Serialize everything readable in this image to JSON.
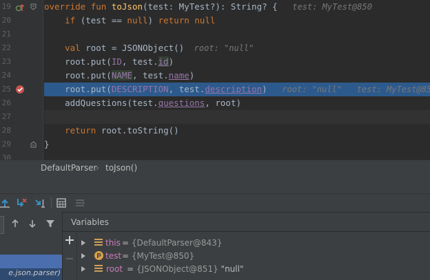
{
  "editor": {
    "line_numbers": [
      "19",
      "20",
      "21",
      "22",
      "23",
      "24",
      "25",
      "26",
      "27",
      "28",
      "29",
      "30"
    ],
    "lines": [
      {
        "segments": [
          {
            "t": "override fun ",
            "c": "kw"
          },
          {
            "t": "toJson",
            "c": "fn"
          },
          {
            "t": "(test: MyTest?): String? {",
            "c": "par"
          },
          {
            "t": "   test: MyTest@850",
            "c": "hint"
          }
        ]
      },
      {
        "segments": [
          {
            "t": "    if ",
            "c": "kw"
          },
          {
            "t": "(test == ",
            "c": "par"
          },
          {
            "t": "null",
            "c": "kw"
          },
          {
            "t": ") ",
            "c": "par"
          },
          {
            "t": "return null",
            "c": "kw"
          }
        ]
      },
      {
        "segments": []
      },
      {
        "segments": [
          {
            "t": "    val ",
            "c": "kw"
          },
          {
            "t": "root = JSONObject()",
            "c": "par"
          },
          {
            "t": "  root: \"null\"",
            "c": "hint"
          }
        ]
      },
      {
        "segments": [
          {
            "t": "    root.put(",
            "c": "par"
          },
          {
            "t": "ID",
            "c": "prop"
          },
          {
            "t": ", test.",
            "c": "par"
          },
          {
            "t": "id",
            "c": "prop-ul"
          },
          {
            "t": ")",
            "c": "par"
          }
        ]
      },
      {
        "segments": [
          {
            "t": "    root.put(",
            "c": "par"
          },
          {
            "t": "NAME",
            "c": "prop"
          },
          {
            "t": ", test.",
            "c": "par"
          },
          {
            "t": "name",
            "c": "prop-ul"
          },
          {
            "t": ")",
            "c": "par"
          }
        ]
      },
      {
        "segments": [
          {
            "t": "    root.put(",
            "c": "par"
          },
          {
            "t": "DESCRIPTION",
            "c": "prop"
          },
          {
            "t": ", test.",
            "c": "par"
          },
          {
            "t": "description",
            "c": "prop-ul"
          },
          {
            "t": ")",
            "c": "par"
          },
          {
            "t": "   root: \"null\"   test: MyTest@850",
            "c": "hint"
          }
        ]
      },
      {
        "segments": [
          {
            "t": "    addQuestions(test.",
            "c": "par"
          },
          {
            "t": "questions",
            "c": "prop-ul"
          },
          {
            "t": ", root)",
            "c": "par"
          }
        ]
      },
      {
        "segments": []
      },
      {
        "segments": [
          {
            "t": "    return ",
            "c": "kw"
          },
          {
            "t": "root.toString()",
            "c": "par"
          }
        ]
      },
      {
        "segments": [
          {
            "t": "}",
            "c": "par"
          }
        ]
      },
      {
        "segments": []
      }
    ]
  },
  "breadcrumb": {
    "class_name": "DefaultParser",
    "separator": "›",
    "method_name": "toJson()"
  },
  "debug": {
    "variables_title": "Variables",
    "frame_text": "e.json.parser)",
    "variables": [
      {
        "name": "this",
        "value": "{DefaultParser@843}",
        "extra": ""
      },
      {
        "name": "test",
        "value": "{MyTest@850}",
        "extra": ""
      },
      {
        "name": "root",
        "value": "{JSONObject@851}",
        "extra": "\"null\""
      }
    ]
  },
  "icons": {
    "breakpoint": "breakpoint-check-icon",
    "override": "override-up-icon",
    "fold": "fold-icon"
  },
  "colors": {
    "highlight": "#2d5a8c",
    "breakpoint": "#c75450",
    "keyword": "#cc7832",
    "function": "#ffc66d",
    "property": "#9876aa"
  }
}
